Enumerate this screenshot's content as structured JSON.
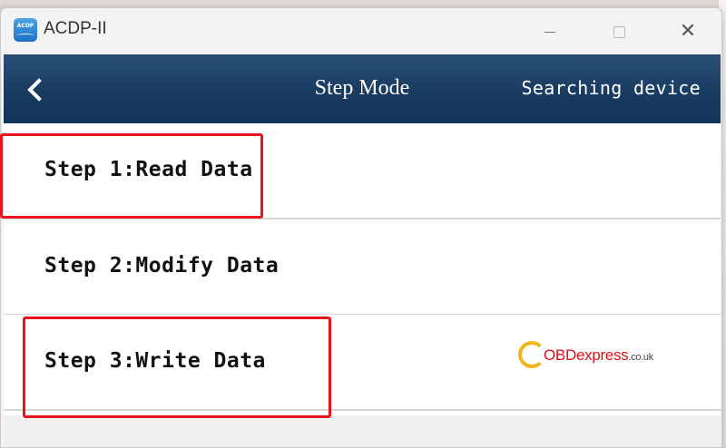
{
  "window": {
    "title": "ACDP-II",
    "icon_text": "ACDP"
  },
  "header": {
    "back_icon": "chevron-left-icon",
    "title": "Step Mode",
    "status": "Searching device"
  },
  "steps": [
    {
      "label": "Step 1:Read Data",
      "highlighted": true
    },
    {
      "label": "Step 2:Modify Data",
      "highlighted": false
    },
    {
      "label": "Step 3:Write Data",
      "highlighted": true
    }
  ],
  "watermark": {
    "brand": "OBDexpress",
    "suffix": ".co.uk"
  },
  "colors": {
    "header_bg": "#1b3f66",
    "highlight": "#e8141b",
    "watermark_red": "#e0101a",
    "watermark_ring": "#f3b51c"
  }
}
